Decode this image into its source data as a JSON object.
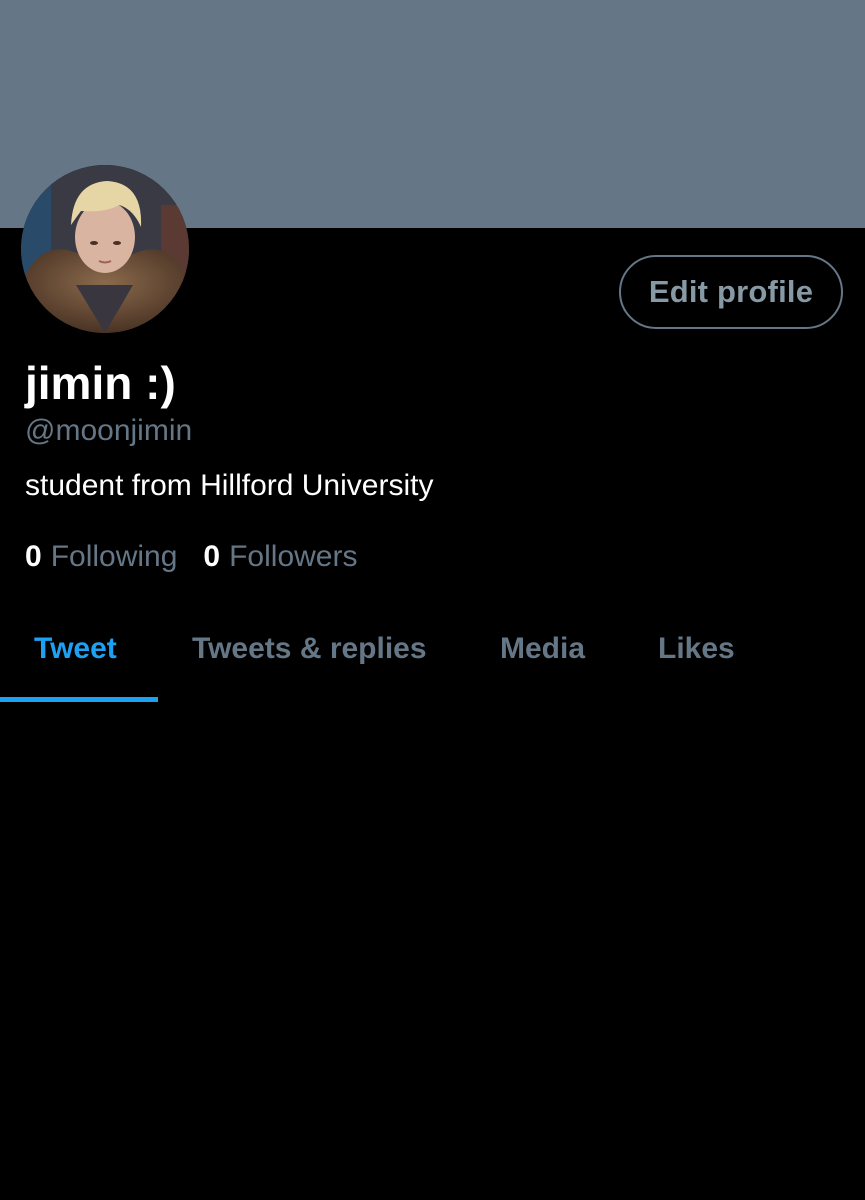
{
  "profile": {
    "display_name": "jimin :)",
    "handle": "@moonjimin",
    "bio": "student from Hillford University",
    "edit_button_label": "Edit profile",
    "banner_color": "#657786",
    "avatar_icon": "profile-photo"
  },
  "stats": {
    "following_count": "0",
    "following_label": "Following",
    "followers_count": "0",
    "followers_label": "Followers"
  },
  "tabs": {
    "items": [
      {
        "label": "Tweet",
        "active": true
      },
      {
        "label": "Tweets & replies",
        "active": false
      },
      {
        "label": "Media",
        "active": false
      },
      {
        "label": "Likes",
        "active": false
      }
    ],
    "accent_color": "#1da1f2",
    "inactive_color": "#657786"
  }
}
